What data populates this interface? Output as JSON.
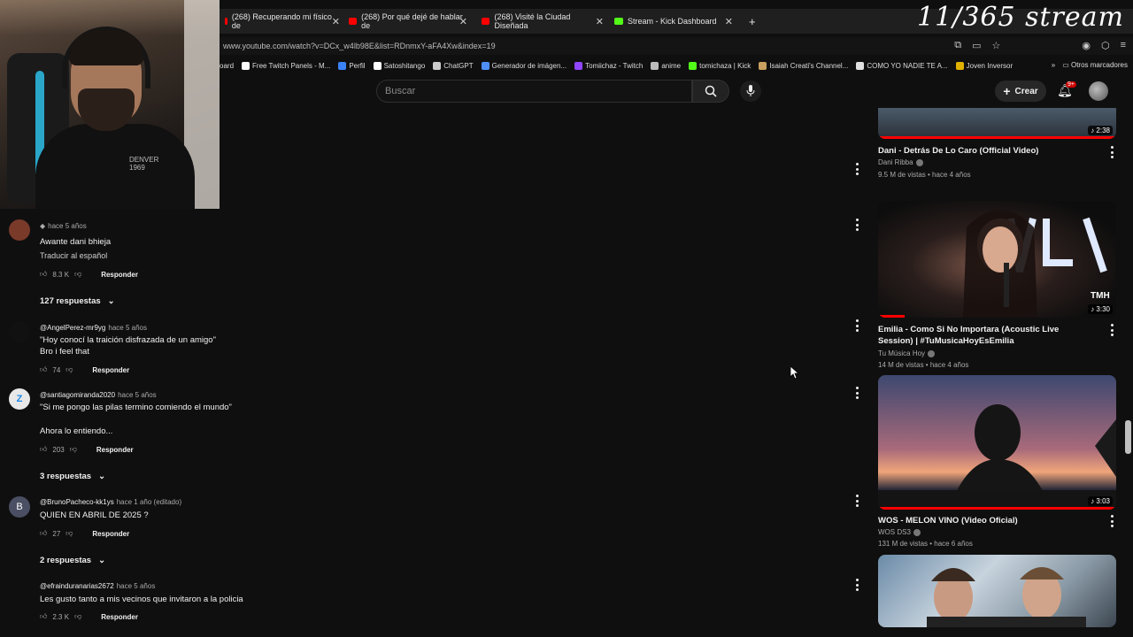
{
  "overlay": {
    "stream_label": "11/365 stream"
  },
  "browser": {
    "tabs": [
      {
        "label": "(268) Recuperando mi físico de",
        "favicon": "youtube-icon"
      },
      {
        "label": "(268) Por qué dejé de hablar de",
        "favicon": "youtube-icon"
      },
      {
        "label": "(268) Visité la Ciudad Diseñada",
        "favicon": "youtube-icon"
      },
      {
        "label": "Stream - Kick Dashboard",
        "favicon": "kick-icon"
      }
    ],
    "url": "www.youtube.com/watch?v=DCx_w4lb98E&list=RDnmxY-aFA4Xw&index=19",
    "bookmarks": [
      {
        "label": "oard",
        "color": "#888888"
      },
      {
        "label": "Free Twitch Panels - M...",
        "color": "#ffffff"
      },
      {
        "label": "Perfil",
        "color": "#3b82f6"
      },
      {
        "label": "Satoshitango",
        "color": "#ffffff"
      },
      {
        "label": "ChatGPT",
        "color": "#cccccc"
      },
      {
        "label": "Generador de imágen...",
        "color": "#4f8ef7"
      },
      {
        "label": "Tomiichaz - Twitch",
        "color": "#9146ff"
      },
      {
        "label": "anime",
        "color": "#bbbbbb"
      },
      {
        "label": "tomichaza | Kick",
        "color": "#53fc18"
      },
      {
        "label": "Isaiah Creati's Channel...",
        "color": "#c8a060"
      },
      {
        "label": "COMO YO NADIE TE A...",
        "color": "#e0e0e0"
      },
      {
        "label": "Joven Inversor",
        "color": "#e0b000"
      }
    ],
    "other_bookmarks": "Otros marcadores"
  },
  "youtube": {
    "search_placeholder": "Buscar",
    "create_label": "Crear",
    "notif_count": "9+"
  },
  "comments": [
    {
      "author": "",
      "time": "hace 5 años",
      "text": "Awante dani bhieja",
      "translate": "Traducir al español",
      "likes": "8.3 K",
      "reply": "Responder",
      "replies": "127 respuestas",
      "avatar_color": "#7a3a2a",
      "avatar_letter": ""
    },
    {
      "author": "@AngelPerez-mr9yg",
      "time": "hace 5 años",
      "text": "\"Hoy conocí la traición disfrazada de un amigo\"",
      "text2": "Bro i feel that",
      "likes": "74",
      "reply": "Responder",
      "avatar_color": "#111111",
      "avatar_letter": ""
    },
    {
      "author": "@santiagomiranda2020",
      "time": "hace 5 años",
      "text": "\"Si me pongo las pilas termino comiendo el mundo\"",
      "text2": "Ahora lo entiendo...",
      "likes": "203",
      "reply": "Responder",
      "replies": "3 respuestas",
      "avatar_color": "#e8e8e8",
      "avatar_letter": "Z"
    },
    {
      "author": "@BrunoPacheco-kk1ys",
      "time": "hace 1 año (editado)",
      "text": "QUIEN EN ABRIL DE 2025 ?",
      "likes": "27",
      "reply": "Responder",
      "replies": "2 respuestas",
      "avatar_color": "#4a4f63",
      "avatar_letter": "B"
    },
    {
      "author": "@efrainduranarias2672",
      "time": "hace 5 años",
      "text": "Les gusto tanto a mis vecinos que invitaron a la policia",
      "likes": "2.3 K",
      "reply": "Responder",
      "avatar_color": "#0f0f0f",
      "avatar_letter": ""
    }
  ],
  "videos": [
    {
      "title": "Dani - Detrás De Lo Caro (Official Video)",
      "channel": "Dani Ribba",
      "meta": "9.5 M de vistas • hace 4 años",
      "duration": "2:38",
      "progress": 1.0
    },
    {
      "title": "Emilia - Como Si No Importara (Acoustic Live Session) | #TuMusicaHoyEsEmilia",
      "channel": "Tu Música Hoy",
      "meta": "14 M de vistas • hace 4 años",
      "duration": "3:30",
      "progress": 0.11
    },
    {
      "title": "WOS - MELON VINO (Video Oficial)",
      "channel": "WOS DS3",
      "meta": "131 M de vistas • hace 6 años",
      "duration": "3:03",
      "progress": 1.0
    }
  ]
}
